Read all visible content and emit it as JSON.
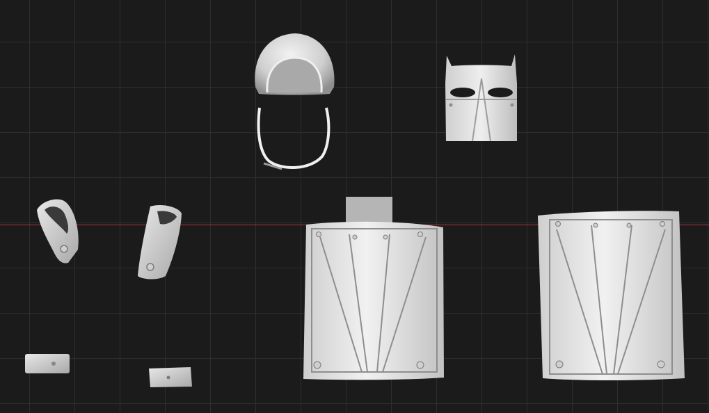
{
  "viewport": {
    "grid_color": "#2e2e2e",
    "background_color": "#1b1b1b",
    "x_axis_color": "#b0333c"
  },
  "meshes": [
    {
      "name": "helmet-cap"
    },
    {
      "name": "chin-strap"
    },
    {
      "name": "face-mask"
    },
    {
      "name": "left-bracer"
    },
    {
      "name": "right-bracer"
    },
    {
      "name": "left-anklet"
    },
    {
      "name": "right-anklet"
    },
    {
      "name": "front-chest-plate"
    },
    {
      "name": "back-chest-plate"
    }
  ],
  "material_color": "#dcdcdc"
}
